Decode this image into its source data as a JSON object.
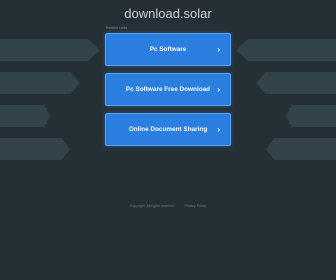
{
  "header": {
    "domain": "download.solar"
  },
  "related_label": "Related Links",
  "links": [
    {
      "label": "Pc Software",
      "chevron": "chevron-right-icon"
    },
    {
      "label": "Pc Software Free Download",
      "chevron": "chevron-right-icon"
    },
    {
      "label": "Online Document Sharing",
      "chevron": "chevron-right-icon"
    }
  ],
  "footer": {
    "copyright": "Copyright. All rights reserved.",
    "privacy": "Privacy Policy"
  },
  "colors": {
    "background": "#253036",
    "button": "#2a7fe0",
    "band": "#33434a"
  }
}
